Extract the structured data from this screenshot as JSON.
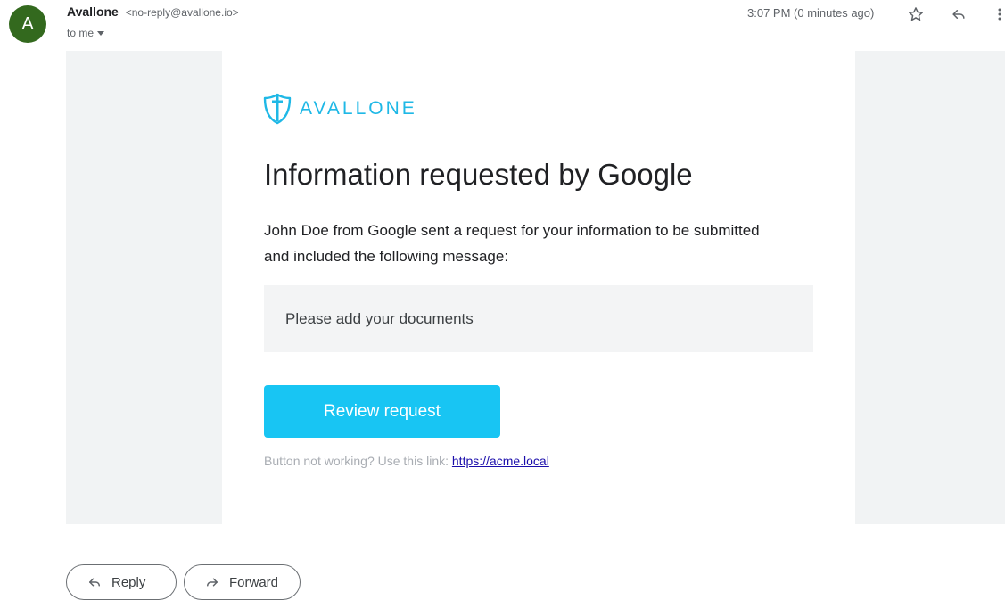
{
  "header": {
    "avatar_letter": "A",
    "avatar_color": "#33691e",
    "sender_name": "Avallone",
    "sender_email": "<no-reply@avallone.io>",
    "recipient": "to me",
    "time": "3:07 PM (0 minutes ago)",
    "icons": [
      "star-icon",
      "reply-icon",
      "more-vert-icon"
    ]
  },
  "email": {
    "logo_text": "AVALLONE",
    "brand_color": "#1fb8e6",
    "title": "Information requested by Google",
    "body": "John Doe from Google sent a request for your information to be submitted and included the following message:",
    "message": "Please add your documents",
    "button_label": "Review request",
    "button_color": "#18c5f3",
    "fallback_text": "Button not working? Use this link:",
    "fallback_link": "https://acme.local"
  },
  "footer": {
    "reply_label": "Reply",
    "forward_label": "Forward"
  }
}
